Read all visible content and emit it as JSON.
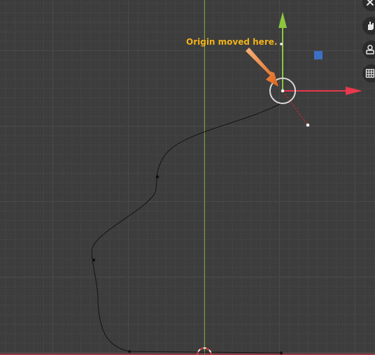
{
  "annotation": {
    "text": "Origin moved here."
  },
  "toolbar": {
    "items": [
      {
        "icon": "close-icon"
      },
      {
        "icon": "hand-icon"
      },
      {
        "icon": "camera-icon"
      },
      {
        "icon": "grid-icon"
      }
    ]
  },
  "colors": {
    "background": "#3d3d3d",
    "grid_major": "#4a4a4a",
    "axis_y_green": "#8cc63f",
    "axis_x_red": "#e8384d",
    "gizmo_blue": "#3d6fc4",
    "annotation": "#f2b21a",
    "arrow": "#e9762b"
  }
}
